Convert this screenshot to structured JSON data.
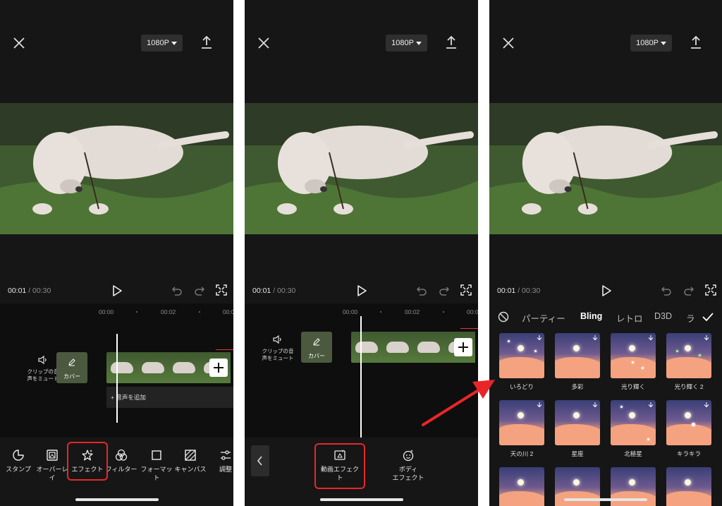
{
  "common": {
    "resolution": "1080P",
    "current_time": "00:01",
    "duration": "/ 00:30",
    "ruler": [
      "00:00",
      "00:02",
      "00:0"
    ]
  },
  "panel1": {
    "mute_label": "クリップの音\n声をミュート",
    "cover_label": "カバー",
    "add_audio": "+ 音声を追加",
    "tools": [
      "スタンプ",
      "オーバーレ\nイ",
      "エフェクト",
      "フィルター",
      "フォーマッ\nト",
      "キャンバス",
      "調整"
    ]
  },
  "panel2": {
    "mute_label": "クリップの音\n声をミュート",
    "cover_label": "カバー",
    "tools": [
      "動画エフェク\nト",
      "ボディ\nエフェクト"
    ]
  },
  "panel3": {
    "tabs": [
      "パーティー",
      "Bling",
      "レトロ",
      "D3D",
      "ラ"
    ],
    "effects": [
      "いろどり",
      "多彩",
      "光り輝く",
      "光り輝く 2",
      "天の川 2",
      "星座",
      "北極星",
      "キラキラ",
      "",
      "",
      "",
      ""
    ]
  },
  "colors": {
    "highlight": "#e8262a",
    "background": "#161616",
    "timeline": "#0e0e0e"
  }
}
